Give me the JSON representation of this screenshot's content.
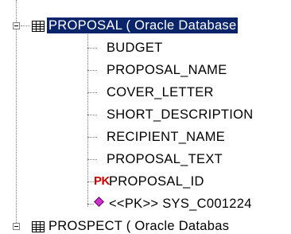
{
  "tree": {
    "table1": {
      "label": "PROPOSAL ( Oracle Database",
      "columns": [
        {
          "label": "BUDGET"
        },
        {
          "label": "PROPOSAL_NAME"
        },
        {
          "label": "COVER_LETTER"
        },
        {
          "label": "SHORT_DESCRIPTION"
        },
        {
          "label": "RECIPIENT_NAME"
        },
        {
          "label": "PROPOSAL_TEXT"
        }
      ],
      "pk_marker": "PK",
      "pk_column": "PROPOSAL_ID",
      "constraint": "<<PK>> SYS_C001224"
    },
    "table2": {
      "label": "PROSPECT ( Oracle Databas"
    }
  },
  "colors": {
    "selection_bg": "#0a246a",
    "pk_red": "#cc0000",
    "constraint_icon": "#cc33cc"
  },
  "icons": {
    "expander": "minus-box-icon",
    "table": "table-grid-icon",
    "constraint": "diamond-icon"
  }
}
